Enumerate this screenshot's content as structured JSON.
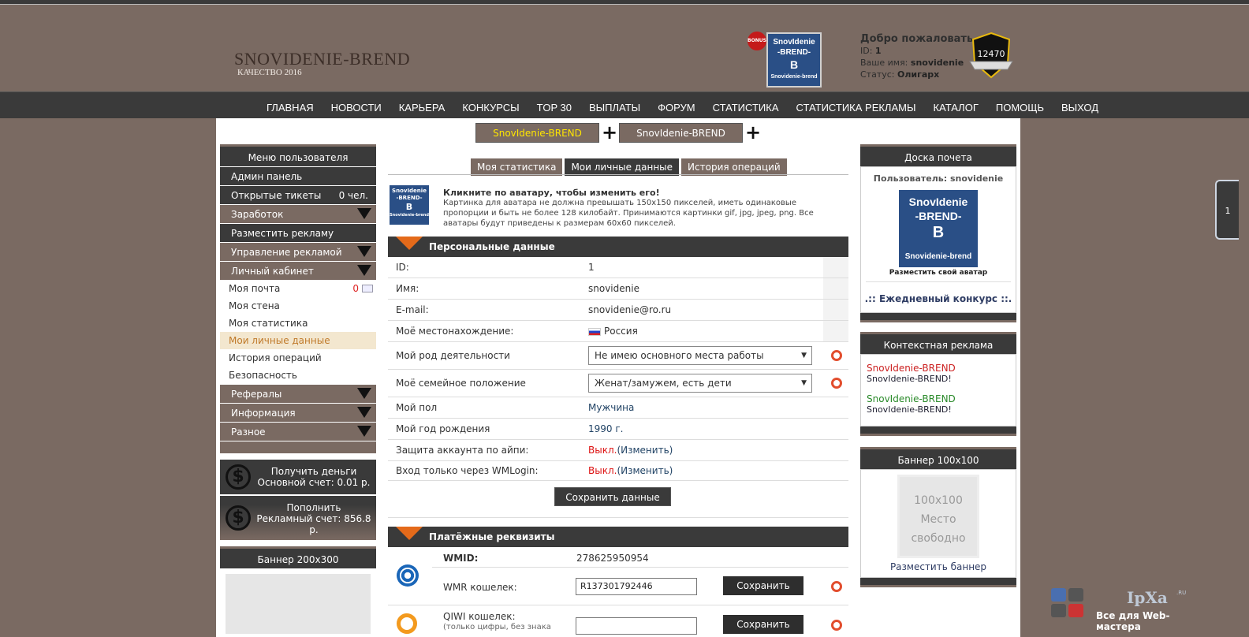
{
  "site": {
    "title": "SNOVIDENIE-BREND",
    "subtitle": "КАЧЕСТВО 2016"
  },
  "header": {
    "bonus_label": "BONUS",
    "avatar_text": [
      "SnovIdenie",
      "-BREND-",
      "B",
      "Snovidenie-brend"
    ],
    "welcome_title": "Добро пожаловать",
    "id_label": "ID:",
    "id_value": "1",
    "name_label": "Ваше имя:",
    "name_value": "snovidenie",
    "status_label": "Статус:",
    "status_value": "Олигарх",
    "rating": "12470"
  },
  "nav": [
    "ГЛАВНАЯ",
    "НОВОСТИ",
    "КАРЬЕРА",
    "КОНКУРСЫ",
    "TOP 30",
    "ВЫПЛАТЫ",
    "ФОРУМ",
    "СТАТИСТИКА",
    "СТАТИСТИКА РЕКЛАМЫ",
    "КАТАЛОГ",
    "ПОМОЩЬ",
    "ВЫХОД"
  ],
  "top_banners": [
    "SnovIdenie-BREND",
    "SnovIdenie-BREND"
  ],
  "colors": {
    "accent_orange": "#e46a1a",
    "dark": "#3a3a3a",
    "brown": "#7a6a62",
    "red": "#d11111",
    "yellow_text": "#ffe600"
  },
  "left_menu": {
    "title": "Меню пользователя",
    "items": [
      {
        "label": "Админ панель",
        "style": "dark"
      },
      {
        "label": "Открытые тикеты",
        "count": "0 чел.",
        "style": "dark"
      },
      {
        "label": "Заработок",
        "style": "brown",
        "arrow": true
      },
      {
        "label": "Разместить рекламу",
        "style": "dark"
      },
      {
        "label": "Управление рекламой",
        "style": "brown",
        "arrow": true
      },
      {
        "label": "Личный кабинет",
        "style": "brown",
        "arrow": true
      }
    ],
    "sub_items": [
      "Моя почта",
      "Моя стена",
      "Моя статистика",
      "Мои личные данные",
      "История операций",
      "Безопасность"
    ],
    "mail_count": "0",
    "items2": [
      "Рефералы",
      "Информация",
      "Разное"
    ]
  },
  "money": {
    "withdraw_title": "Получить деньги",
    "withdraw_text": "Основной счет: 0.01 р.",
    "deposit_title": "Пополнить",
    "deposit_text": "Рекламный счет: 856.8 р.",
    "icon": "dollar-icon"
  },
  "banner200": {
    "title": "Баннер 200х300"
  },
  "tabs": [
    "Моя статистика",
    "Мои личные данные",
    "История операций"
  ],
  "avatar_info": {
    "title": "Кликните по аватару, чтобы изменить его!",
    "text": "Картинка для аватара не должна превышать 150х150 пикселей, иметь одинаковые пропорции и быть не более 128 килобайт. Принимаются картинки gif, jpg, jpeg, png. Все аватары будут приведены к размерам 60х60 пикселей."
  },
  "personal": {
    "title": "Персональные данные",
    "rows": [
      {
        "label": "ID:",
        "value": "1"
      },
      {
        "label": "Имя:",
        "value": "snovidenie"
      },
      {
        "label": "E-mail:",
        "value": "snovidenie@ro.ru"
      },
      {
        "label": "Моё местонахождение:",
        "value": "Россия"
      },
      {
        "label": "Мой род деятельности",
        "value": "Не имею основного места работы"
      },
      {
        "label": "Моё семейное положение",
        "value": "Женат/замужем, есть дети"
      },
      {
        "label": "Мой пол",
        "value": "Мужчина"
      },
      {
        "label": "Мой год рождения",
        "value": "1990 г."
      },
      {
        "label": "Защита аккаунта по айпи:",
        "value_red": "Выкл.",
        "value_link": "(Изменить)"
      },
      {
        "label": "Вход только через WMLogin:",
        "value_red": "Выкл.",
        "value_link": "(Изменить)"
      }
    ],
    "save_label": "Сохранить данные"
  },
  "payments": {
    "title": "Платёжные реквизиты",
    "wmid_label": "WMID:",
    "wmid_value": "278625950954",
    "wmr_label": "WMR кошелек:",
    "wmr_value": "R137301792446",
    "qiwi_label": "QIWI кошелек:",
    "qiwi_hint": "(только цифры, без знака",
    "save_label": "Сохранить"
  },
  "right": {
    "honour_title": "Доска почета",
    "honour_user": "Пользователь: snovidenie",
    "place_avatar": "Разместить свой аватар",
    "daily": ".:: Ежедневный конкурс ::.",
    "context_title": "Контекстная реклама",
    "context": [
      {
        "link": "SnovIdenie-BREND",
        "desc": "SnovIdenie-BREND!"
      },
      {
        "link": "SnovIdenie-BREND",
        "desc": "SnovIdenie-BREND!"
      }
    ],
    "banner_title": "Баннер 100х100",
    "banner_lines": [
      "100x100",
      "Место",
      "свободно"
    ],
    "place_banner": "Разместить баннер"
  },
  "side_tab": "1",
  "watermark": {
    "word": "IpXa",
    "ru": ".RU",
    "sub": "Все для Web-мастера"
  }
}
